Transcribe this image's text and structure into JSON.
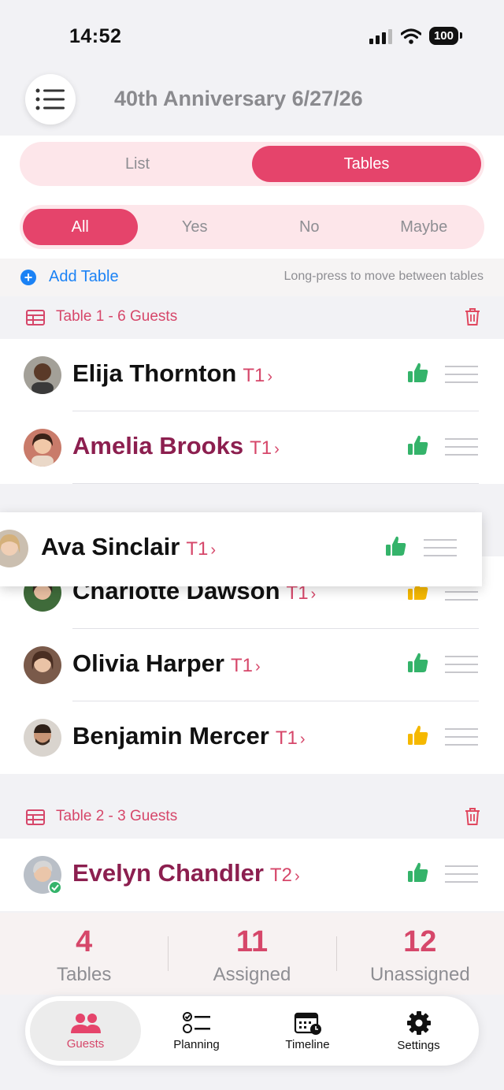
{
  "status_bar": {
    "time": "14:52",
    "battery": "100"
  },
  "header": {
    "title": "40th Anniversary 6/27/26"
  },
  "view_toggle": {
    "list_label": "List",
    "tables_label": "Tables"
  },
  "rsvp_filter": {
    "all": "All",
    "yes": "Yes",
    "no": "No",
    "maybe": "Maybe"
  },
  "add_table": {
    "label": "Add Table",
    "hint": "Long-press to move between tables"
  },
  "tables": [
    {
      "header": "Table 1 - 6 Guests",
      "guests": [
        {
          "name": "Elija Thornton",
          "table": "T1",
          "rsvp": "yes",
          "name_color": "#111111"
        },
        {
          "name": "Amelia Brooks",
          "table": "T1",
          "rsvp": "yes",
          "name_color": "#8c1f4f"
        },
        {
          "name": "Charlotte Dawson",
          "table": "T1",
          "rsvp": "maybe",
          "name_color": "#111111"
        },
        {
          "name": "Olivia Harper",
          "table": "T1",
          "rsvp": "yes",
          "name_color": "#111111"
        },
        {
          "name": "Benjamin Mercer",
          "table": "T1",
          "rsvp": "maybe",
          "name_color": "#111111"
        }
      ]
    },
    {
      "header": "Table 2 - 3 Guests",
      "guests": [
        {
          "name": "Evelyn Chandler",
          "table": "T2",
          "rsvp": "yes",
          "name_color": "#8c1f4f"
        }
      ]
    }
  ],
  "dragging_guest": {
    "name": "Ava Sinclair",
    "table": "T1",
    "rsvp": "yes"
  },
  "stats": [
    {
      "value": "4",
      "label": "Tables"
    },
    {
      "value": "11",
      "label": "Assigned"
    },
    {
      "value": "12",
      "label": "Unassigned"
    }
  ],
  "tab_bar": [
    {
      "label": "Guests",
      "icon": "people-icon",
      "active": true
    },
    {
      "label": "Planning",
      "icon": "checklist-icon",
      "active": false
    },
    {
      "label": "Timeline",
      "icon": "calendar-clock-icon",
      "active": false
    },
    {
      "label": "Settings",
      "icon": "gear-icon",
      "active": false
    }
  ],
  "colors": {
    "accent": "#e5446b",
    "yes": "#34b36a",
    "maybe": "#f5b800",
    "link": "#1b82f5"
  }
}
